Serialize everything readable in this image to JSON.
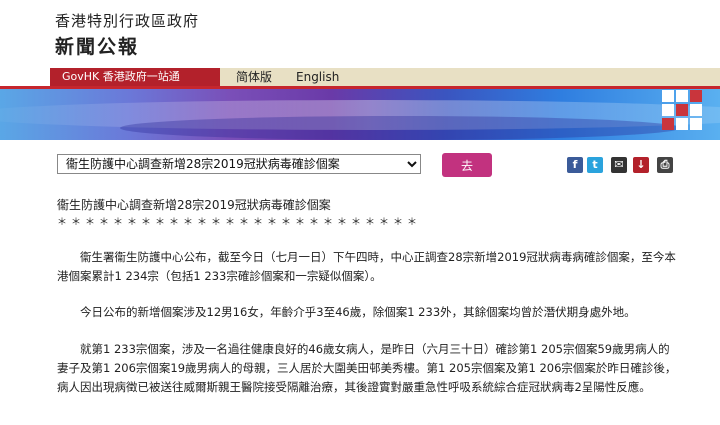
{
  "header": {
    "department": "香港特別行政區政府",
    "site_title": "新聞公報"
  },
  "nav": {
    "govhk_label": "GovHK 香港政府一站通",
    "simplified_label": "简体版",
    "english_label": "English"
  },
  "toolbar": {
    "selected_title": "衞生防護中心調查新增28宗2019冠狀病毒確診個案",
    "go_label": "去",
    "share_icons": [
      "facebook-icon",
      "twitter-icon",
      "email-icon",
      "download-icon",
      "print-icon"
    ]
  },
  "article": {
    "headline": "衞生防護中心調查新增28宗2019冠狀病毒確診個案",
    "separator": "＊＊＊＊＊＊＊＊＊＊＊＊＊＊＊＊＊＊＊＊＊＊＊＊＊＊",
    "paragraphs": [
      "衞生署衞生防護中心公布，截至今日（七月一日）下午四時，中心正調查28宗新增2019冠狀病毒病確診個案，至今本港個案累計1 234宗（包括1 233宗確診個案和一宗疑似個案）。",
      "今日公布的新增個案涉及12男16女，年齡介乎3至46歲，除個案1 233外，其餘個案均曾於潛伏期身處外地。",
      "就第1 233宗個案，涉及一名過往健康良好的46歲女病人，是昨日（六月三十日）確診第1 205宗個案59歲男病人的妻子及第1 206宗個案19歲男病人的母親，三人居於大圍美田邨美秀樓。第1 205宗個案及第1 206宗個案於昨日確診後，病人因出現病徵已被送往威爾斯親王醫院接受隔離治療，其後證實對嚴重急性呼吸系統綜合症冠狀病毒2呈陽性反應。"
    ]
  },
  "colors": {
    "govhk_red": "#b3212b",
    "go_button": "#c2327f",
    "nav_strip": "#e8e0c4"
  }
}
